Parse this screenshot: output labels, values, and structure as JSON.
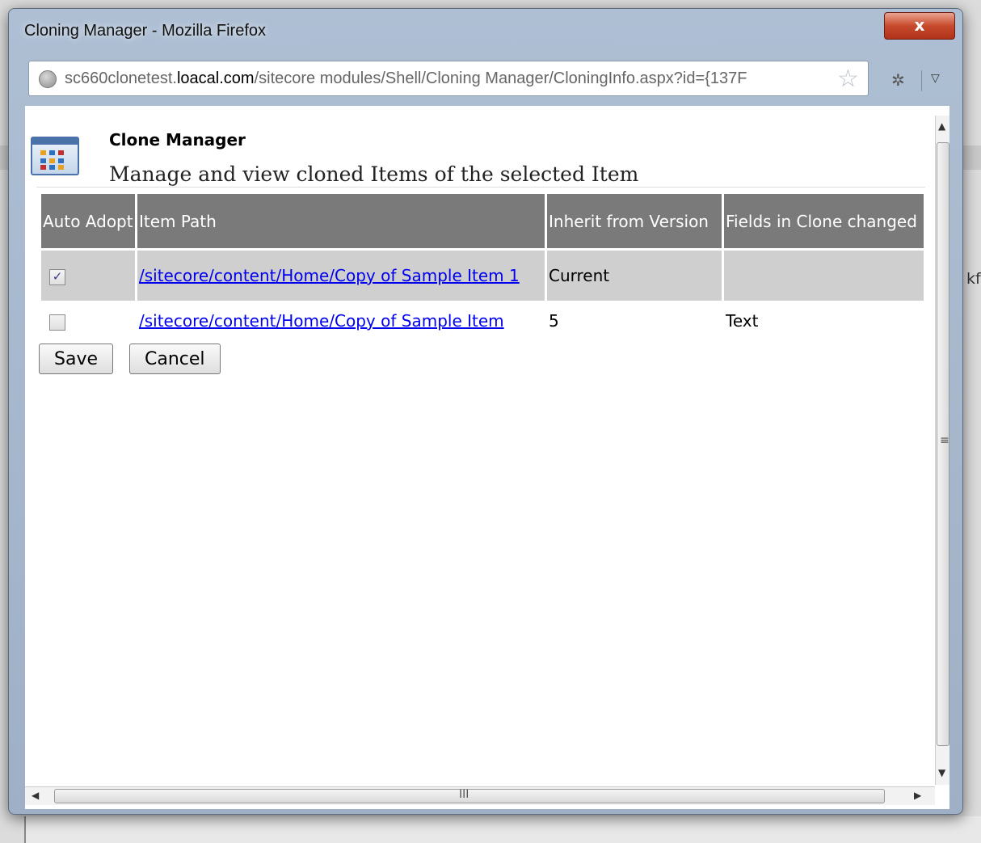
{
  "window": {
    "title": "Cloning Manager - Mozilla Firefox",
    "close_label": "x"
  },
  "urlbar": {
    "url_prefix": "sc660clonetest.",
    "url_domain": "loacal.com",
    "url_path": "/sitecore modules/Shell/Cloning Manager/CloningInfo.aspx?id={137F"
  },
  "background_fragment": "kfl",
  "header": {
    "title": "Clone Manager",
    "subtitle": "Manage and view cloned Items of the selected Item"
  },
  "table": {
    "columns": [
      "Auto Adopt",
      "Item Path",
      "Inherit from Version",
      "Fields in Clone changed"
    ],
    "rows": [
      {
        "auto_adopt": true,
        "path": "/sitecore/content/Home/Copy of Sample Item 1",
        "version": "Current",
        "fields": ""
      },
      {
        "auto_adopt": false,
        "path": "/sitecore/content/Home/Copy of Sample Item",
        "version": "5",
        "fields": "Text"
      }
    ]
  },
  "buttons": {
    "save_label": "Save",
    "cancel_label": "Cancel"
  },
  "icons": {
    "check_glyph": "✓",
    "scroll_grip_v": "≡",
    "scroll_grip_h": "III"
  },
  "colors": {
    "header_bg": "#7a7a7a",
    "alt_row_bg": "#cfcfcf",
    "link": "#0000ee"
  }
}
